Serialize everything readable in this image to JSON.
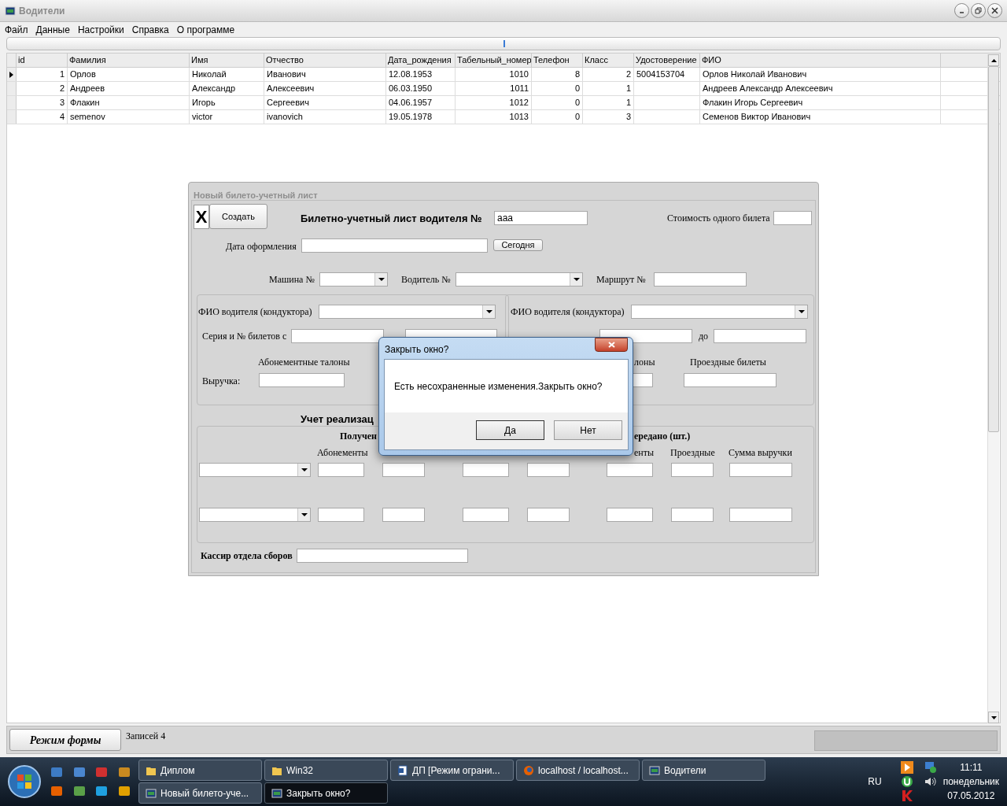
{
  "window": {
    "title": "Водители"
  },
  "menu": [
    "Файл",
    "Данные",
    "Настройки",
    "Справка",
    "О программе"
  ],
  "progress": {
    "level": 0.5
  },
  "grid": {
    "columns": [
      "id",
      "Фамилия",
      "Имя",
      "Отчество",
      "Дата_рождения",
      "Табельный_номер",
      "Телефон",
      "Класс",
      "Удостоверение",
      "ФИО"
    ],
    "rows": [
      {
        "current": true,
        "cells": [
          "1",
          "Орлов",
          "Николай",
          "Иванович",
          "12.08.1953",
          "1010",
          "8",
          "2",
          "5004153704",
          "Орлов Николай Иванович"
        ]
      },
      {
        "current": false,
        "cells": [
          "2",
          "Андреев",
          "Александр",
          "Алексеевич",
          "06.03.1950",
          "1011",
          "0",
          "1",
          "",
          "Андреев Александр Алексеевич"
        ]
      },
      {
        "current": false,
        "cells": [
          "3",
          "Флакин",
          "Игорь",
          "Сергеевич",
          "04.06.1957",
          "1012",
          "0",
          "1",
          "",
          "Флакин Игорь Сергеевич"
        ]
      },
      {
        "current": false,
        "cells": [
          "4",
          "semenov",
          "victor",
          "ivanovich",
          "19.05.1978",
          "1013",
          "0",
          "3",
          "",
          "Семенов Виктор Иванович"
        ]
      }
    ]
  },
  "form": {
    "title": "Новый билето-учетный лист",
    "close_button": "X",
    "create_button": "Создать",
    "heading": "Билетно-учетный лист водителя №",
    "number_value": "aaa",
    "ticket_price_label": "Стоимость одного билета",
    "date_label": "Дата оформления",
    "today_button": "Сегодня",
    "car_label": "Машина №",
    "driver_label": "Водитель №",
    "route_label": "Маршрут №",
    "left_group": {
      "fio_label": "ФИО водителя (кондуктора)",
      "series_label": "Серия и № билетов с",
      "season_label": "Абонементные талоны",
      "revenue_label": "Выручка:"
    },
    "right_group": {
      "fio_label": "ФИО водителя (кондуктора)",
      "to_label": "до",
      "season_label": "лоны",
      "travel_label": "Проездные билеты"
    },
    "sales_heading": "Учет реализац",
    "received_label": "Получен",
    "passed_label": "ередано (шт.)",
    "col_season": "Абонементы",
    "col_season_right": "енты",
    "col_travel": "Проездные",
    "col_sum": "Сумма выручки",
    "cashier_label": "Кассир отдела сборов"
  },
  "dialog": {
    "title": "Закрыть окно?",
    "message": "Есть несохраненные изменения.Закрыть окно?",
    "buttons": [
      "Да",
      "Нет"
    ]
  },
  "status": {
    "mode_button": "Режим формы",
    "records": "Записей 4"
  },
  "taskbar": {
    "tasks": [
      {
        "label": "Диплом",
        "kind": "folder",
        "selected": false
      },
      {
        "label": "Win32",
        "kind": "folder",
        "selected": false
      },
      {
        "label": "ДП [Режим ограни...",
        "kind": "doc",
        "selected": false
      },
      {
        "label": "localhost / localhost...",
        "kind": "browser",
        "selected": false
      },
      {
        "label": "Водители",
        "kind": "app",
        "selected": false
      },
      {
        "label": "Новый билето-уче...",
        "kind": "app",
        "selected": false
      },
      {
        "label": "Закрыть окно?",
        "kind": "app",
        "selected": true
      }
    ],
    "language": "RU",
    "time": "11:11",
    "weekday": "понедельник",
    "date": "07.05.2012"
  }
}
